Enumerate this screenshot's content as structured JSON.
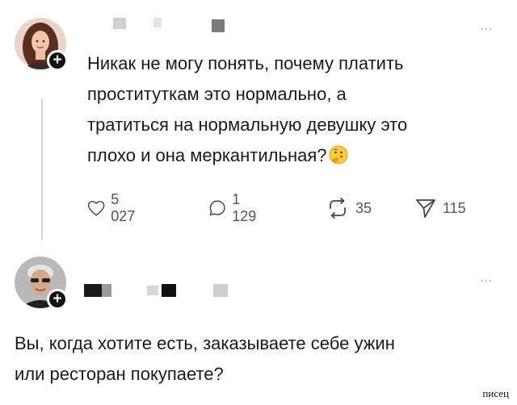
{
  "post1": {
    "text_lines": [
      "Никак не могу понять, почему платить",
      "проституткам это нормально, а",
      "тратиться на нормальную девушку это",
      "плохо и она меркантильная?"
    ],
    "emoji": "thinking-face-emoji",
    "more": "...",
    "follow_symbol": "+",
    "actions": {
      "likes": "5 027",
      "replies": "1 129",
      "reposts": "35",
      "shares": "115"
    }
  },
  "post2": {
    "text_lines": [
      "Вы, когда хотите есть, заказываете себе ужин",
      "или ресторан покупаете?"
    ],
    "more": "...",
    "follow_symbol": "+"
  },
  "watermark": "писец",
  "colors": {
    "background": "#ffffff",
    "text": "#1a1a1a",
    "muted": "#555555",
    "thread_line": "#d8d8d8"
  }
}
